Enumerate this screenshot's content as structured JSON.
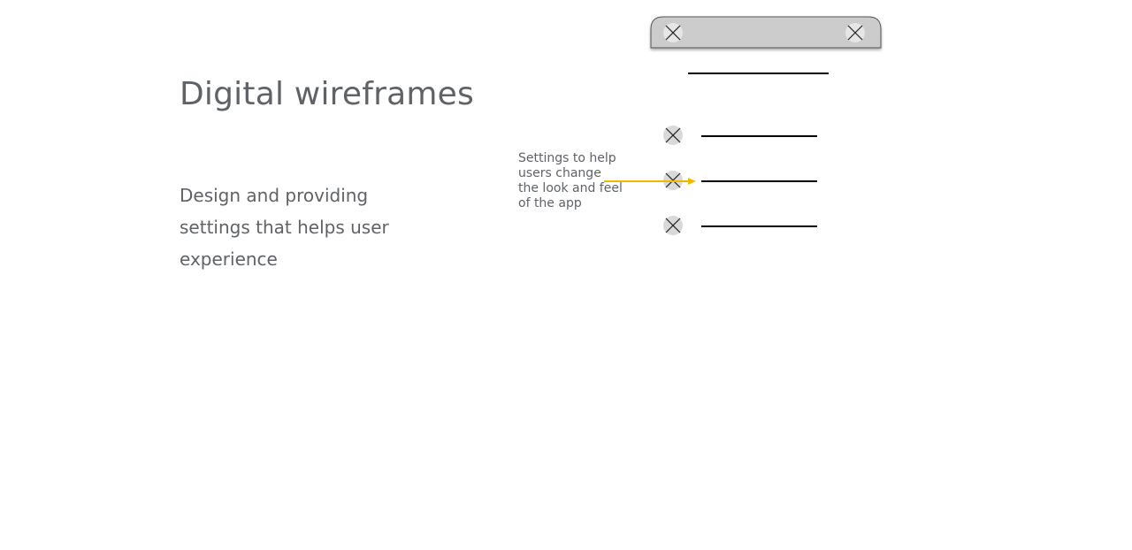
{
  "slide": {
    "title": "Digital wireframes",
    "body": "Design and providing settings that helps user experience"
  },
  "annotation": {
    "text": "Settings to help users change the look and feel of the app"
  },
  "wireframe": {
    "header_left_icon": "placeholder-x-icon",
    "header_right_icon": "placeholder-x-icon",
    "settings_rows": [
      {
        "icon": "placeholder-x-icon"
      },
      {
        "icon": "placeholder-x-icon"
      },
      {
        "icon": "placeholder-x-icon"
      }
    ]
  },
  "colors": {
    "text": "#5f6368",
    "header_bar": "#cccccc",
    "placeholder_icon": "#d9d9d9",
    "line": "#000000",
    "arrow": "#f1b800"
  }
}
